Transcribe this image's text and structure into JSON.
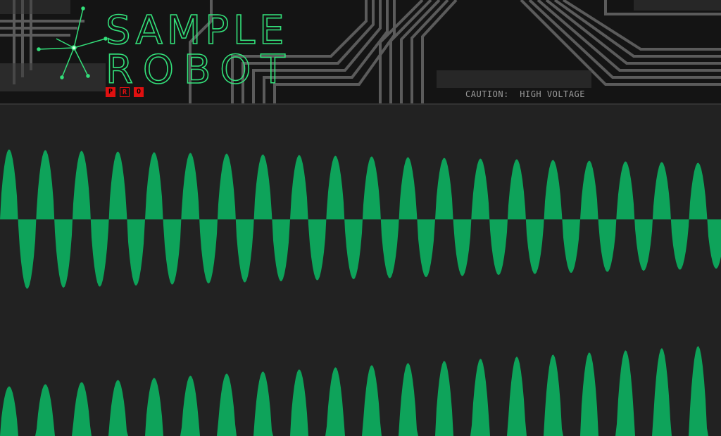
{
  "app": {
    "title_line1": "SAMPLE",
    "title_line2": "ROBOT",
    "badge": [
      "P",
      "R",
      "O"
    ]
  },
  "header": {
    "caution_text": "CAUTION:  HIGH VOLTAGE"
  },
  "colors": {
    "logo_green": "#33e07a",
    "badge_red": "#e01010",
    "waveform_green": "#0ea35a",
    "background": "#222222",
    "header_bg": "#141414",
    "trace": "#5b5b5b"
  },
  "icons": {
    "logo_mark": "spark-star-icon"
  },
  "waveform": {
    "channels": 2,
    "channel_labels": [
      "left-channel",
      "right-channel"
    ]
  }
}
